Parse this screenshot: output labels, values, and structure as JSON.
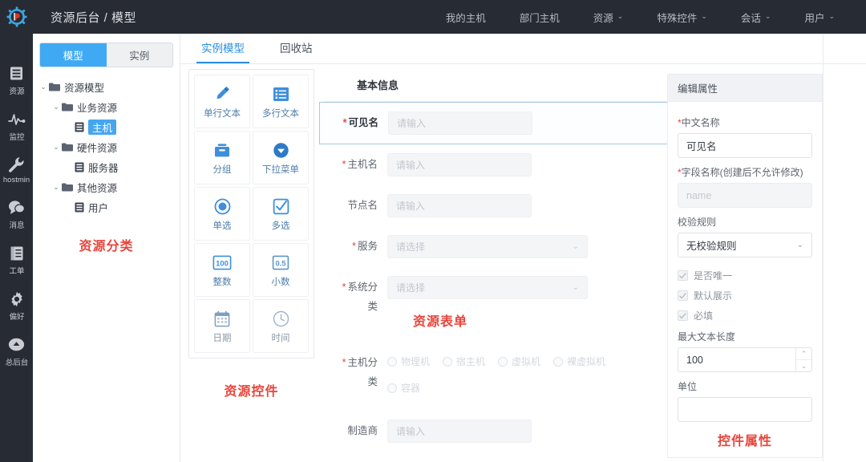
{
  "header": {
    "logo_icon": "gear-logo-icon",
    "title": "资源后台 / 模型",
    "nav": [
      {
        "label": "我的主机",
        "has_caret": false
      },
      {
        "label": "部门主机",
        "has_caret": false
      },
      {
        "label": "资源",
        "has_caret": true
      },
      {
        "label": "特殊控件",
        "has_caret": true
      },
      {
        "label": "会话",
        "has_caret": true
      },
      {
        "label": "用户",
        "has_caret": true
      }
    ],
    "caret_glyph": "⌄",
    "bg_color": "#272b33"
  },
  "rail": {
    "items": [
      {
        "label": "资源",
        "icon": "list-document-icon",
        "active": true
      },
      {
        "label": "监控",
        "icon": "heartbeat-pulse-icon",
        "active": false
      },
      {
        "label": "hostmin",
        "icon": "wrench-icon",
        "active": false
      },
      {
        "label": "消息",
        "icon": "chat-bubble-icon",
        "active": false
      },
      {
        "label": "工单",
        "icon": "clipboard-icon",
        "active": false
      },
      {
        "label": "偏好",
        "icon": "gear-icon",
        "active": false
      },
      {
        "label": "总后台",
        "icon": "circle-up-arrow-icon",
        "active": false
      }
    ]
  },
  "tree_panel": {
    "segments": [
      {
        "label": "模型",
        "active": true
      },
      {
        "label": "实例",
        "active": false
      }
    ],
    "nodes": [
      {
        "label": "资源模型",
        "depth": 0,
        "type": "folder",
        "expanded": true,
        "selected": false
      },
      {
        "label": "业务资源",
        "depth": 1,
        "type": "folder",
        "expanded": true,
        "selected": false
      },
      {
        "label": "主机",
        "depth": 2,
        "type": "model",
        "expanded": false,
        "selected": true
      },
      {
        "label": "硬件资源",
        "depth": 1,
        "type": "folder",
        "expanded": true,
        "selected": false
      },
      {
        "label": "服务器",
        "depth": 2,
        "type": "model",
        "expanded": false,
        "selected": false
      },
      {
        "label": "其他资源",
        "depth": 1,
        "type": "folder",
        "expanded": true,
        "selected": false
      },
      {
        "label": "用户",
        "depth": 2,
        "type": "model",
        "expanded": false,
        "selected": false
      }
    ],
    "annotation": "资源分类",
    "annotation_color": "#e8453c",
    "arrow_glyph": "⌄"
  },
  "tabs": [
    {
      "label": "实例模型",
      "active": true
    },
    {
      "label": "回收站",
      "active": false
    }
  ],
  "palette": {
    "annotation": "资源控件",
    "widgets": [
      {
        "label": "单行文本",
        "icon": "pencil-icon",
        "style": "blue"
      },
      {
        "label": "多行文本",
        "icon": "list-lines-icon",
        "style": "blue"
      },
      {
        "label": "分组",
        "icon": "inbox-tray-icon",
        "style": "blue"
      },
      {
        "label": "下拉菜单",
        "icon": "dropdown-circle-icon",
        "style": "blue"
      },
      {
        "label": "单选",
        "icon": "radio-circle-icon",
        "style": "blue"
      },
      {
        "label": "多选",
        "icon": "checkbox-square-icon",
        "style": "blue"
      },
      {
        "label": "整数",
        "icon": "number-100-icon",
        "style": "blue"
      },
      {
        "label": "小数",
        "icon": "decimal-05-icon",
        "style": "blue"
      },
      {
        "label": "日期",
        "icon": "calendar-icon",
        "style": "faint"
      },
      {
        "label": "时间",
        "icon": "clock-icon",
        "style": "faint"
      }
    ]
  },
  "form": {
    "section_title": "基本信息",
    "annotation": "资源表单",
    "input_placeholder": "请输入",
    "select_placeholder": "请选择",
    "dropdown_glyph": "⌄",
    "rows": [
      {
        "label": "可见名",
        "required": true,
        "type": "input",
        "selected": true,
        "two_line": false
      },
      {
        "label": "主机名",
        "required": true,
        "type": "input",
        "selected": false,
        "two_line": false
      },
      {
        "label": "节点名",
        "required": false,
        "type": "input",
        "selected": false,
        "two_line": false
      },
      {
        "label": "服务",
        "required": true,
        "type": "select",
        "selected": false,
        "two_line": false
      },
      {
        "label": "系统分",
        "label_line2": "类",
        "required": true,
        "type": "select",
        "selected": false,
        "two_line": true
      },
      {
        "label": "主机分",
        "label_line2": "类",
        "required": true,
        "type": "radio",
        "selected": false,
        "two_line": true,
        "options": [
          "物理机",
          "宿主机",
          "虚拟机",
          "裸虚拟机",
          "容器"
        ]
      },
      {
        "label": "制造商",
        "required": false,
        "type": "input",
        "selected": false,
        "two_line": false
      }
    ]
  },
  "properties": {
    "title": "编辑属性",
    "annotation": "控件属性",
    "fields": {
      "cn_name_label": "中文名称",
      "cn_name_required": true,
      "cn_name_value": "可见名",
      "field_name_label": "字段名称(创建后不允许修改)",
      "field_name_required": true,
      "field_name_placeholder": "name",
      "rule_label": "校验规则",
      "rule_value": "无校验规则",
      "max_len_label": "最大文本长度",
      "max_len_value": "100",
      "unit_label": "单位",
      "unit_value": ""
    },
    "checkboxes": [
      {
        "label": "是否唯一",
        "checked": true,
        "disabled": true
      },
      {
        "label": "默认展示",
        "checked": true,
        "disabled": true
      },
      {
        "label": "必填",
        "checked": true,
        "disabled": true
      }
    ],
    "stepper_up_glyph": "⌃",
    "stepper_down_glyph": "⌄",
    "dropdown_glyph": "⌄"
  }
}
